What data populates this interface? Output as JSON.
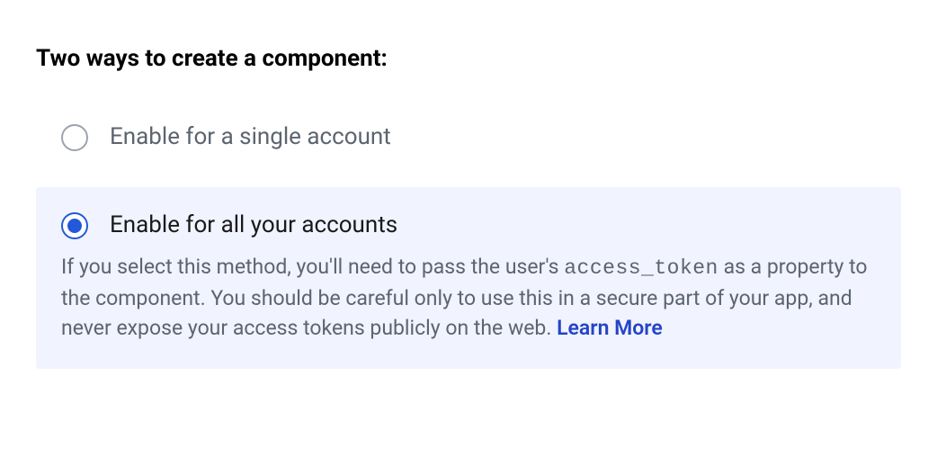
{
  "heading": "Two ways to create a component:",
  "options": [
    {
      "label": "Enable for a single account",
      "selected": false
    },
    {
      "label": "Enable for all your accounts",
      "selected": true,
      "description_pre": "If you select this method, you'll need to pass the user's ",
      "description_code": "access_token",
      "description_post": " as a property to the component. You should be careful only to use this in a secure part of your app, and never expose your access tokens publicly on the web. ",
      "learn_more_label": "Learn More"
    }
  ]
}
